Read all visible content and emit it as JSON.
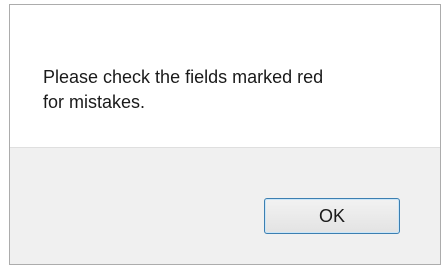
{
  "dialog": {
    "message": "Please check the fields marked red\nfor mistakes.",
    "ok_label": "OK"
  }
}
